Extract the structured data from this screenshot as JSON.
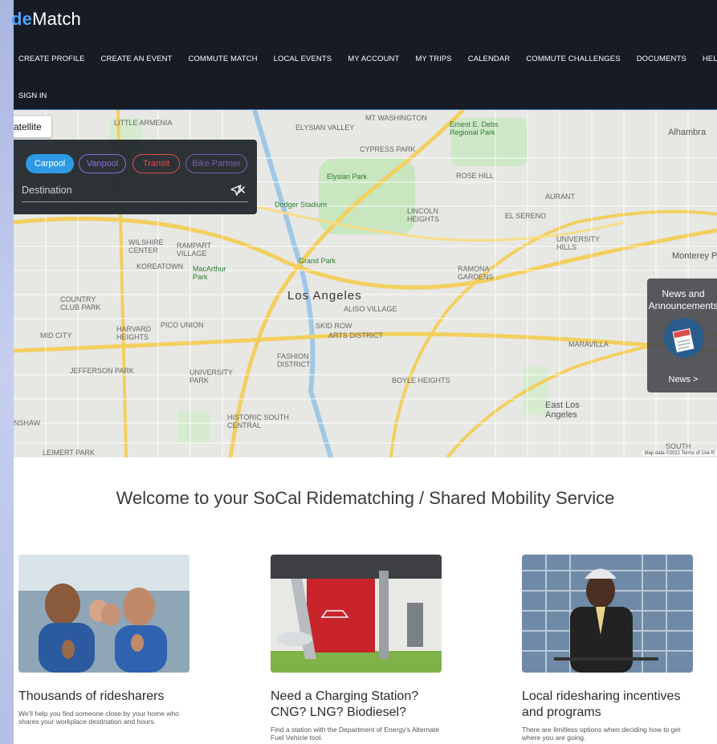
{
  "brand": {
    "prefix": "de",
    "suffix": "Match"
  },
  "nav": {
    "items": [
      "CREATE PROFILE",
      "CREATE AN EVENT",
      "COMMUTE MATCH",
      "LOCAL EVENTS",
      "MY ACCOUNT",
      "MY TRIPS",
      "CALENDAR",
      "COMMUTE CHALLENGES",
      "DOCUMENTS",
      "HELP"
    ],
    "sign_in": "SIGN IN"
  },
  "map": {
    "satellite_label": "atellite",
    "modes": [
      "Carpool",
      "Vanpool",
      "Transit",
      "Bike Partner"
    ],
    "destination_placeholder": "Destination",
    "attribution": "Map data ©2021   Terms of Use   R",
    "labels": {
      "la": "Los Angeles",
      "alhambra": "Alhambra",
      "monterey": "Monterey P",
      "east_la": "East Los Angeles",
      "boyle": "BOYLE HEIGHTS",
      "el_sereno": "EL SERENO",
      "lincoln": "LINCOLN HEIGHTS",
      "elysian_valley": "ELYSIAN VALLEY",
      "elysian_park": "Elysian Park",
      "dodger": "Dodger Stadium",
      "cypress": "CYPRESS PARK",
      "koreatown": "KOREATOWN",
      "wilshire": "WILSHIRE CENTER",
      "harvard": "HARVARD HEIGHTS",
      "pico": "PICO UNION",
      "jefferson": "JEFFERSON PARK",
      "univpark": "UNIVERSITY PARK",
      "fashion": "FASHION DISTRICT",
      "skid": "SKID ROW",
      "arts": "ARTS DISTRICT",
      "aliso": "ALISO VILLAGE",
      "historic": "HISTORIC SOUTH CENTRAL",
      "macarthur": "MacArthur Park",
      "grand": "Grand Park",
      "maravilla": "MARAVILLA",
      "ramona": "RAMONA GARDENS",
      "rose": "ROSE HILL",
      "mtwash": "MT WASHINGTON",
      "debs": "Ernest E. Debs Regional Park",
      "little_armenia": "LITTLE ARMENIA",
      "rampart": "RAMPART VILLAGE",
      "country": "COUNTRY CLUB PARK",
      "midcity": "MID CITY",
      "leimert": "LEIMERT PARK",
      "nshaw": "NSHAW",
      "aurant": "AURANT",
      "univhills": "UNIVERSITY HILLS",
      "south": "SOUTH"
    },
    "news": {
      "title": "News and Announcements",
      "link": "News >"
    }
  },
  "welcome": "Welcome to your SoCal Ridematching / Shared Mobility Service",
  "cards": [
    {
      "title": "Thousands of ridesharers",
      "text": "We'll help you find someone close by your home who shares your workplace destination and hours."
    },
    {
      "title": "Need a Charging Station? CNG? LNG? Biodiesel?",
      "text": "Find a station with the Department of Energy's Alternate Fuel Vehicle tool."
    },
    {
      "title": "Local ridesharing incentives and programs",
      "text": "There are limitless options when deciding how to get where you are going."
    }
  ],
  "colors": {
    "header_bg": "#161b24",
    "accent": "#2e9ae6",
    "brand_blue": "#4da3ff"
  }
}
